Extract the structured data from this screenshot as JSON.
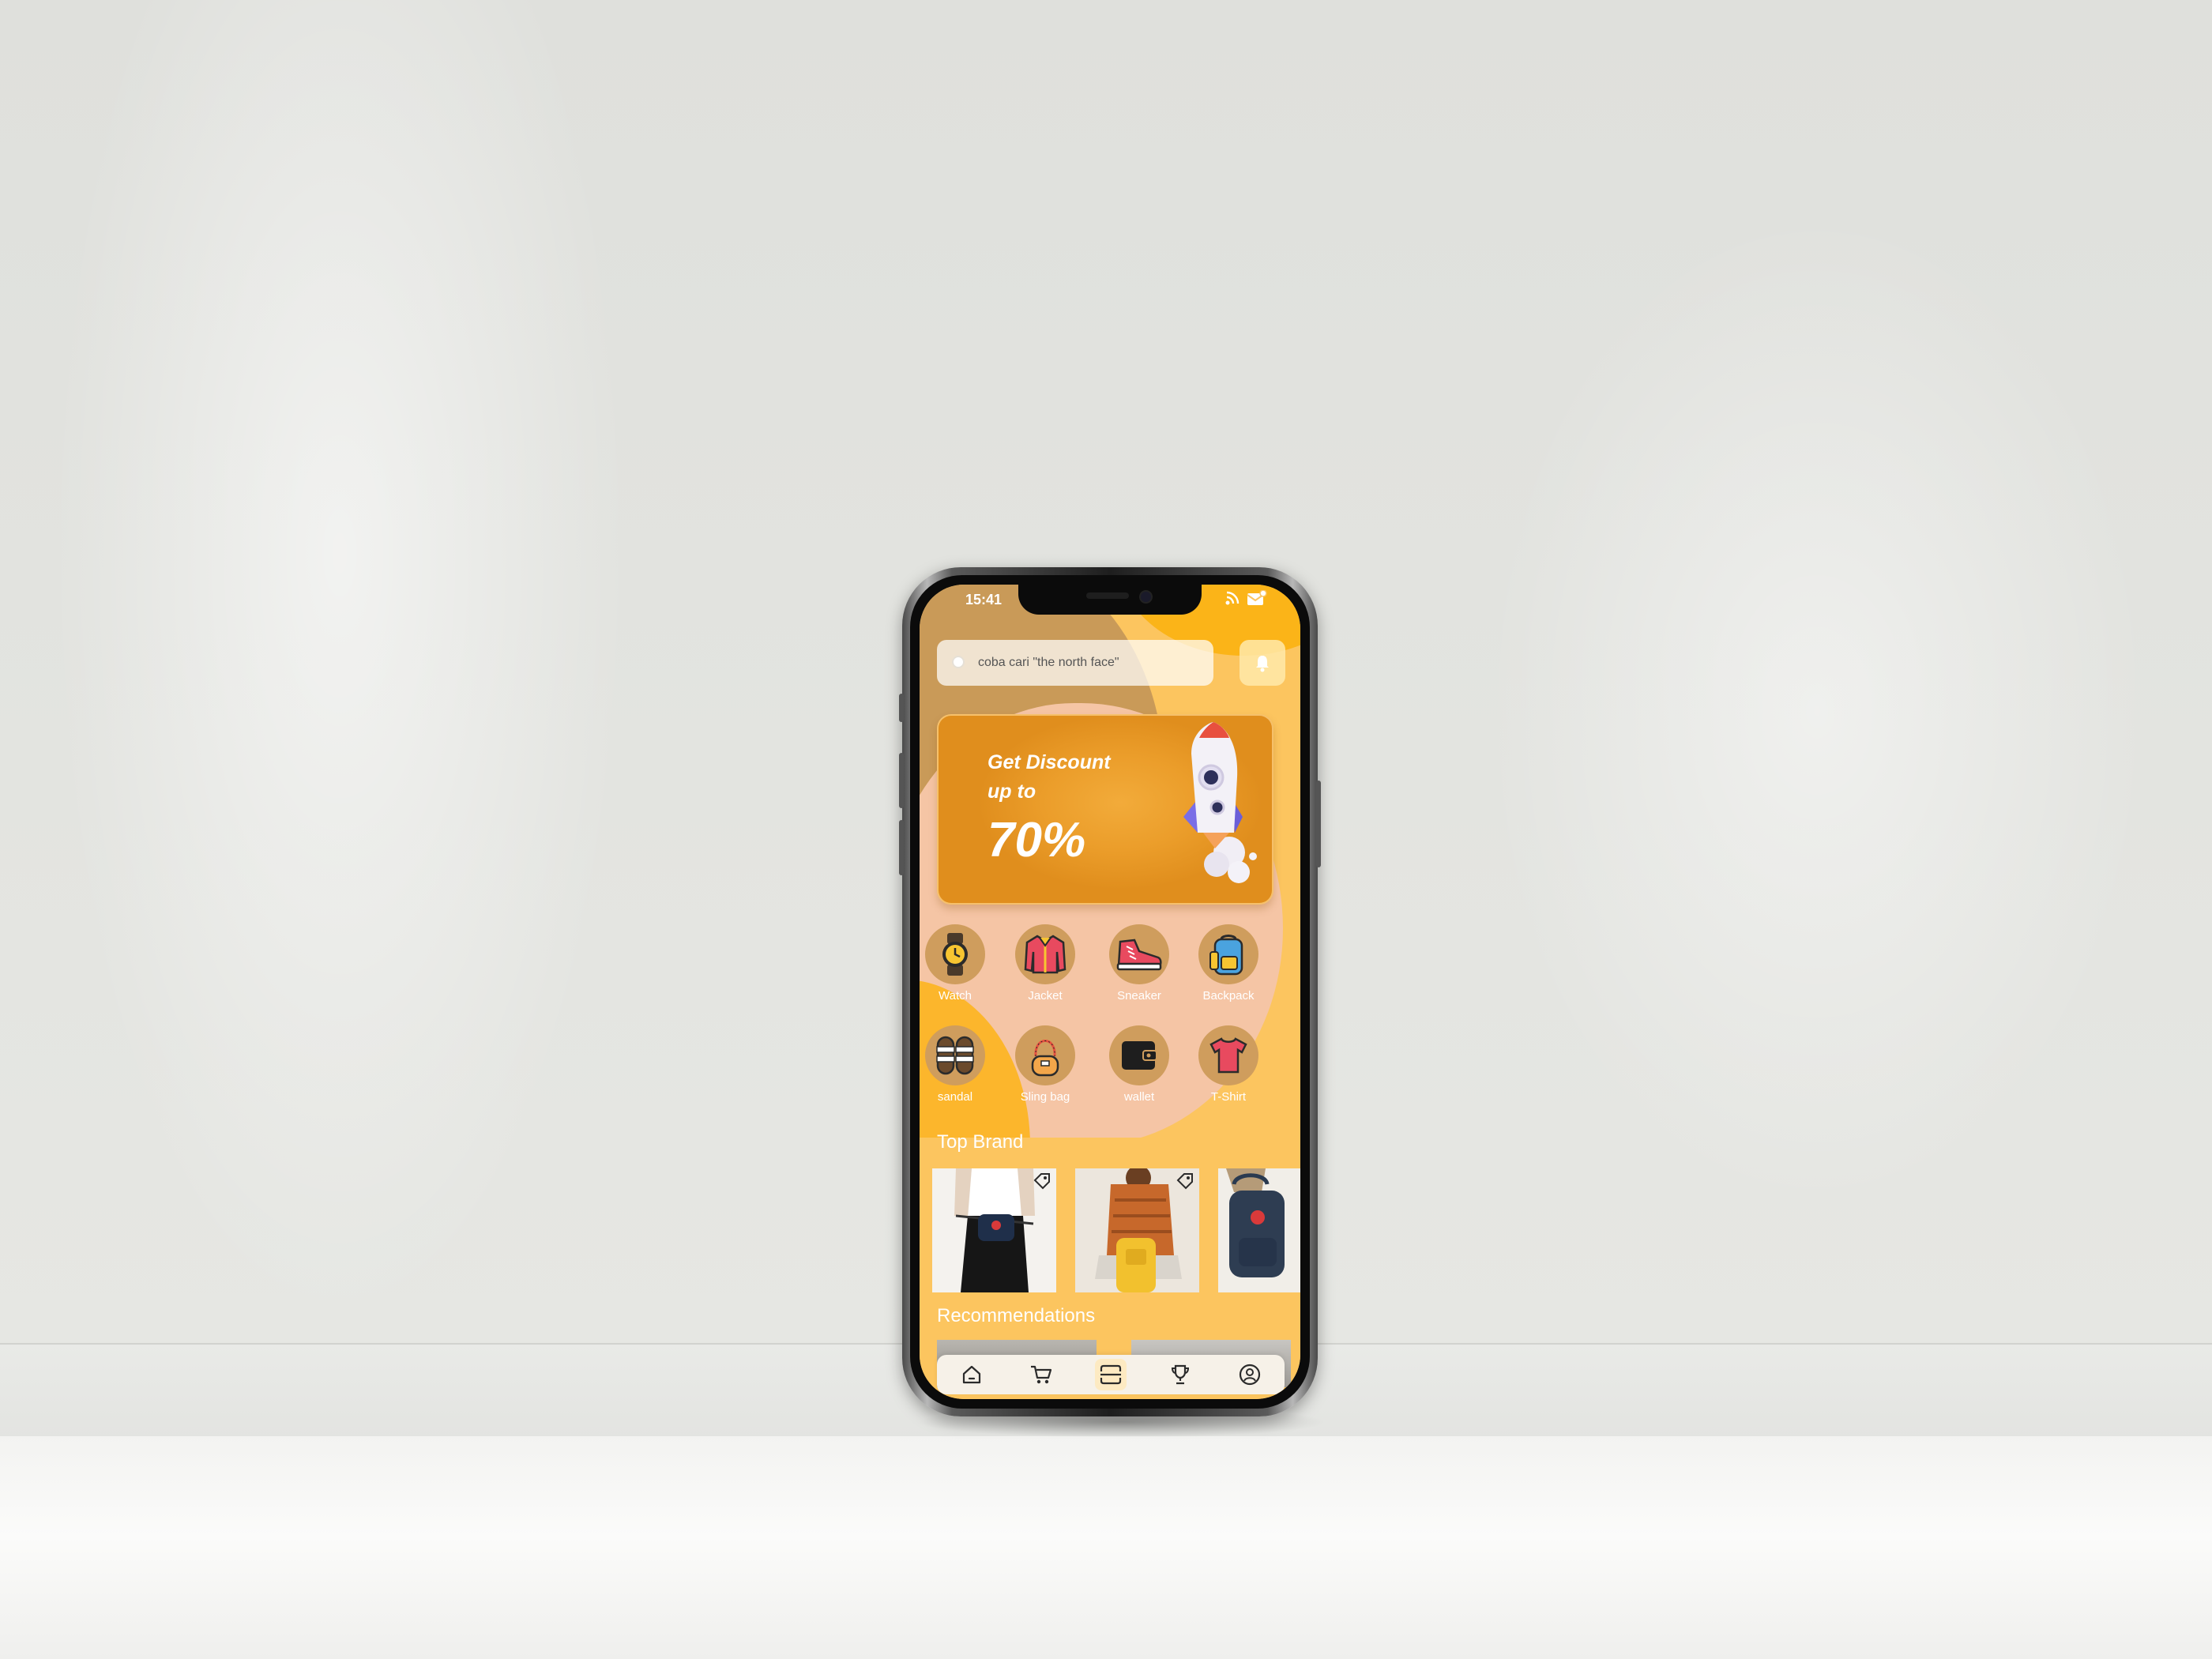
{
  "status_bar": {
    "time": "15:41"
  },
  "search": {
    "placeholder": "coba cari \"the north face\""
  },
  "banner": {
    "line1": "Get Discount",
    "line2": "up to",
    "percent": "70%"
  },
  "categories": [
    {
      "label": "Watch",
      "icon": "watch-icon"
    },
    {
      "label": "Jacket",
      "icon": "jacket-icon"
    },
    {
      "label": "Sneaker",
      "icon": "sneaker-icon"
    },
    {
      "label": "Backpack",
      "icon": "backpack-icon"
    },
    {
      "label": "sandal",
      "icon": "sandal-icon"
    },
    {
      "label": "Sling bag",
      "icon": "sling-bag-icon"
    },
    {
      "label": "wallet",
      "icon": "wallet-icon"
    },
    {
      "label": "T-Shirt",
      "icon": "tshirt-icon"
    }
  ],
  "sections": {
    "top_brand": "Top Brand",
    "recommendations": "Recommendations"
  },
  "tabbar": {
    "items": [
      "home-icon",
      "cart-icon",
      "scan-icon",
      "trophy-icon",
      "profile-icon"
    ],
    "active": 2
  },
  "colors": {
    "background": "#fcc55f",
    "accent": "#eb9d2a",
    "category_circle": "#cf9d5d",
    "blob_dark": "#c99a58",
    "blob_light": "#f5c5a5"
  }
}
